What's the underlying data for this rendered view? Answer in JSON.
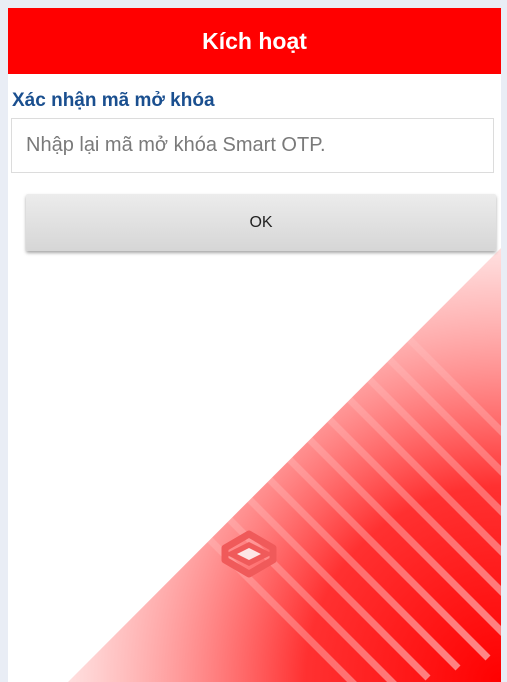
{
  "header": {
    "title": "Kích hoạt"
  },
  "form": {
    "label": "Xác nhận mã mở khóa",
    "input_placeholder": "Nhập lại mã mở khóa Smart OTP.",
    "input_value": "",
    "ok_label": "OK"
  },
  "colors": {
    "brand_red": "#ff0000",
    "label_blue": "#1a4f8f"
  },
  "icons": {
    "logo": "bank-logo-icon"
  }
}
